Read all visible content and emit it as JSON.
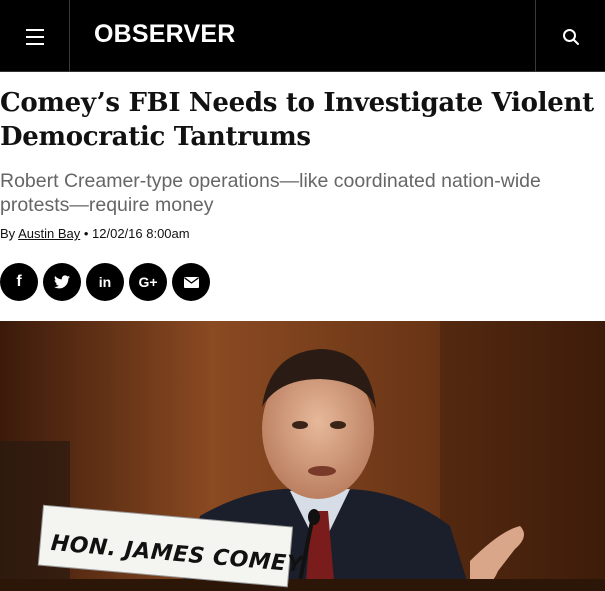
{
  "header": {
    "logo": "OBSERVER",
    "menu_icon": "hamburger-menu-icon",
    "search_icon": "search-icon"
  },
  "article": {
    "headline": "Comey’s FBI Needs to Investigate Violent Democratic Tantrums",
    "dek": "Robert Creamer-type operations—like coordinated nation-wide protests—require money",
    "byline_prefix": "By",
    "author": "Austin Bay",
    "separator": " • ",
    "date": "12/02/16 8:00am"
  },
  "share": {
    "facebook": "f",
    "twitter": "twitter-icon",
    "linkedin": "in",
    "googleplus": "G+",
    "email": "email-icon"
  },
  "hero": {
    "nameplate": "HON. JAMES COMEY"
  },
  "colors": {
    "topbar": "#000000",
    "headline": "#111111",
    "dek": "#666666"
  }
}
